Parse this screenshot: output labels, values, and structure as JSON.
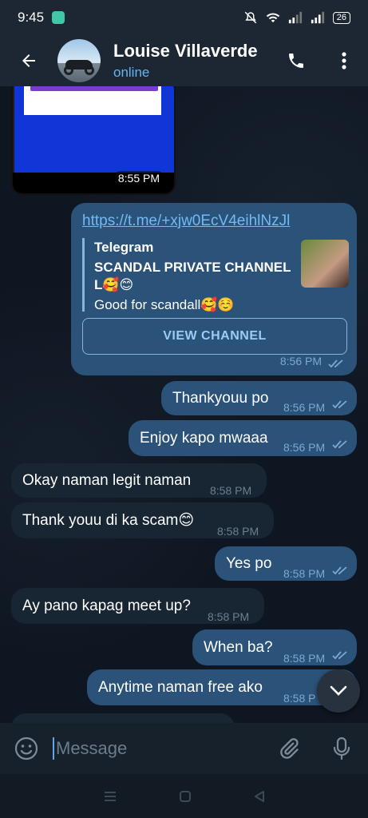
{
  "status_bar": {
    "time": "9:45",
    "battery": "26"
  },
  "header": {
    "name": "Louise Villaverde",
    "status": "online"
  },
  "image_message": {
    "time": "8:55 PM"
  },
  "link_message": {
    "url": "https://t.me/+xjw0EcV4eihlNzJl",
    "preview_site": "Telegram",
    "preview_title": "SCANDAL PRIVATE CHANNEL L🥰😊",
    "preview_desc": "Good for scandall🥰☺️",
    "button": "VIEW CHANNEL",
    "time": "8:56 PM"
  },
  "messages": [
    {
      "text": "Thankyouu po",
      "time": "8:56 PM",
      "out": true
    },
    {
      "text": "Enjoy kapo mwaaa",
      "time": "8:56 PM",
      "out": true
    },
    {
      "text": "Okay naman legit naman",
      "time": "8:58 PM",
      "out": false
    },
    {
      "text": "Thank youu di ka scam😊",
      "time": "8:58 PM",
      "out": false
    },
    {
      "text": "Yes po",
      "time": "8:58 PM",
      "out": true
    },
    {
      "text": "Ay pano kapag meet up?",
      "time": "8:58 PM",
      "out": false
    },
    {
      "text": "When ba?",
      "time": "8:58 PM",
      "out": true
    },
    {
      "text": "Anytime naman free ako",
      "time": "8:58 P",
      "out": true
    }
  ],
  "composer": {
    "placeholder": "Message"
  },
  "colors": {
    "outgoing": "#2b5278",
    "incoming": "#182533",
    "accent": "#64b5ef"
  }
}
